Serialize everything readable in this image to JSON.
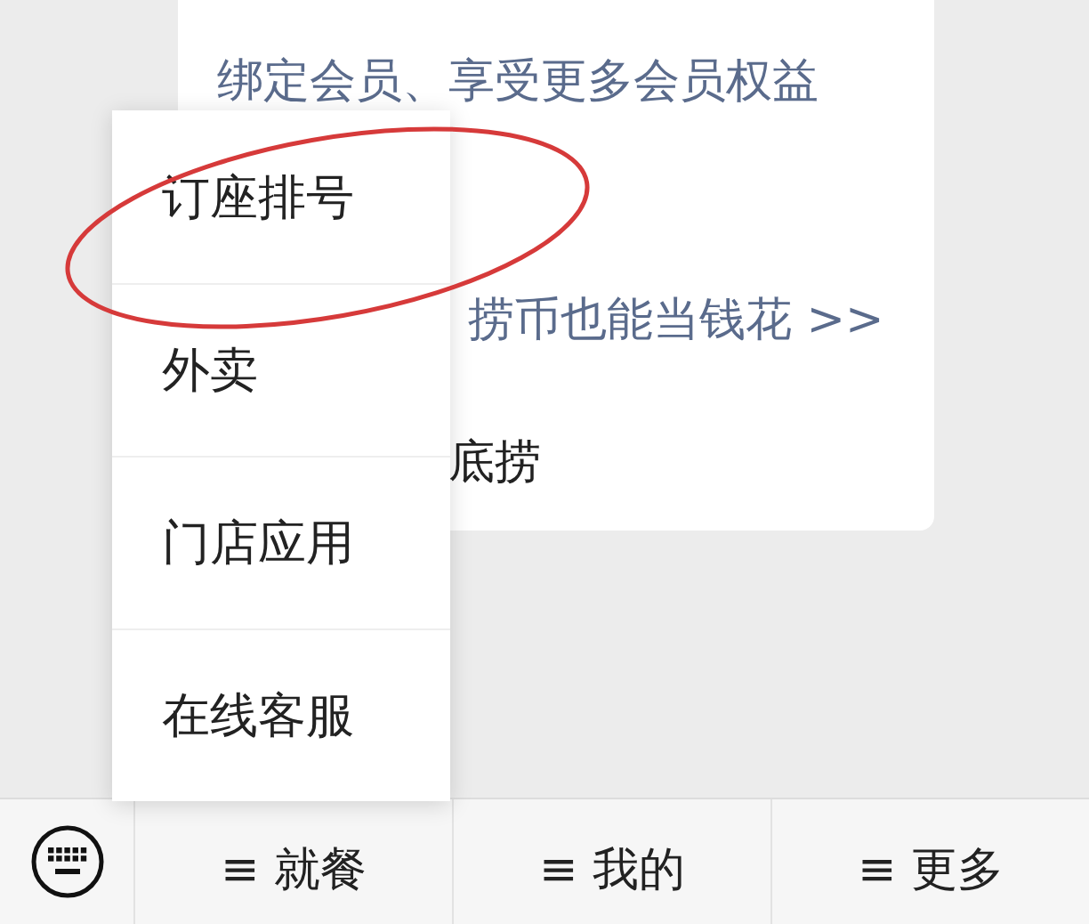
{
  "card": {
    "lines": [
      "绑定会员、享受更多会员权益",
      "捞币也能当钱花 >>",
      "底捞"
    ]
  },
  "popup_menu": {
    "items": [
      "订座排号",
      "外卖",
      "门店应用",
      "在线客服"
    ]
  },
  "bottom_bar": {
    "tabs": [
      "≡ 就餐",
      "≡ 我的",
      "≡ 更多"
    ]
  }
}
